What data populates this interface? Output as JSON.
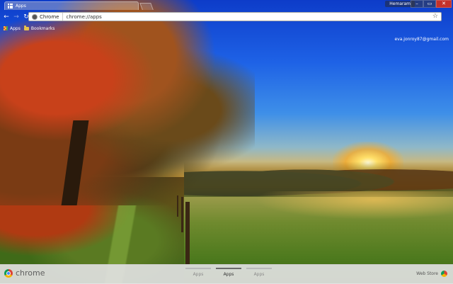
{
  "window": {
    "tab_title": "Apps",
    "profile_name": "Hemaram",
    "controls": {
      "minimize": "–",
      "maximize": "▭",
      "close": "✕"
    }
  },
  "toolbar": {
    "back_icon": "←",
    "forward_icon": "→",
    "reload_icon": "↻",
    "chip_label": "Chrome",
    "url_scheme": "chrome://",
    "url_path": "apps",
    "star_icon": "☆"
  },
  "bookmarks": [
    {
      "label": "Apps",
      "icon": "apps-grid-icon"
    },
    {
      "label": "Bookmarks",
      "icon": "folder-icon"
    }
  ],
  "account": {
    "email": "eva.jonroy87@gmail.com"
  },
  "launcher": {
    "brand": "chrome",
    "pages": [
      {
        "label": "Apps",
        "active": false
      },
      {
        "label": "Apps",
        "active": true
      },
      {
        "label": "Apps",
        "active": false
      }
    ],
    "webstore_label": "Web Store"
  },
  "colors": {
    "close_button": "#c4312a",
    "omnibox_bg": "#ffffff",
    "launcher_bg": "#e1e1e1"
  }
}
